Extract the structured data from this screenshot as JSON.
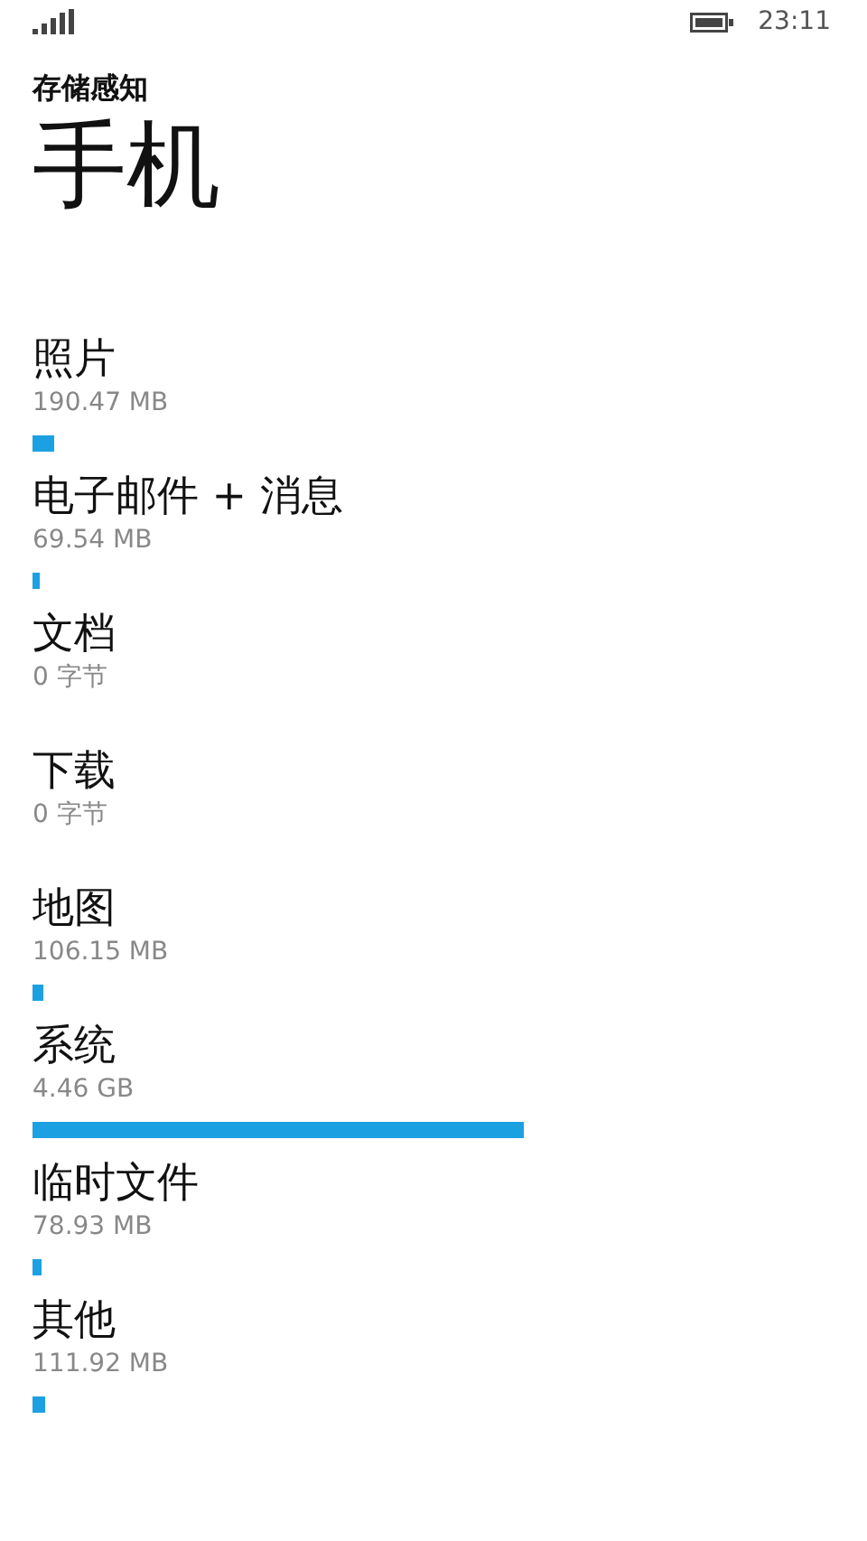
{
  "status_bar": {
    "time": "23:11"
  },
  "header": {
    "subtitle": "存储感知",
    "title": "手机"
  },
  "categories": [
    {
      "name": "照片",
      "size": "190.47 MB"
    },
    {
      "name": "电子邮件 + 消息",
      "size": "69.54 MB"
    },
    {
      "name": "文档",
      "size": "0 字节"
    },
    {
      "name": "下载",
      "size": "0 字节"
    },
    {
      "name": "地图",
      "size": "106.15 MB"
    },
    {
      "name": "系统",
      "size": "4.46 GB"
    },
    {
      "name": "临时文件",
      "size": "78.93 MB"
    },
    {
      "name": "其他",
      "size": "111.92 MB"
    }
  ]
}
